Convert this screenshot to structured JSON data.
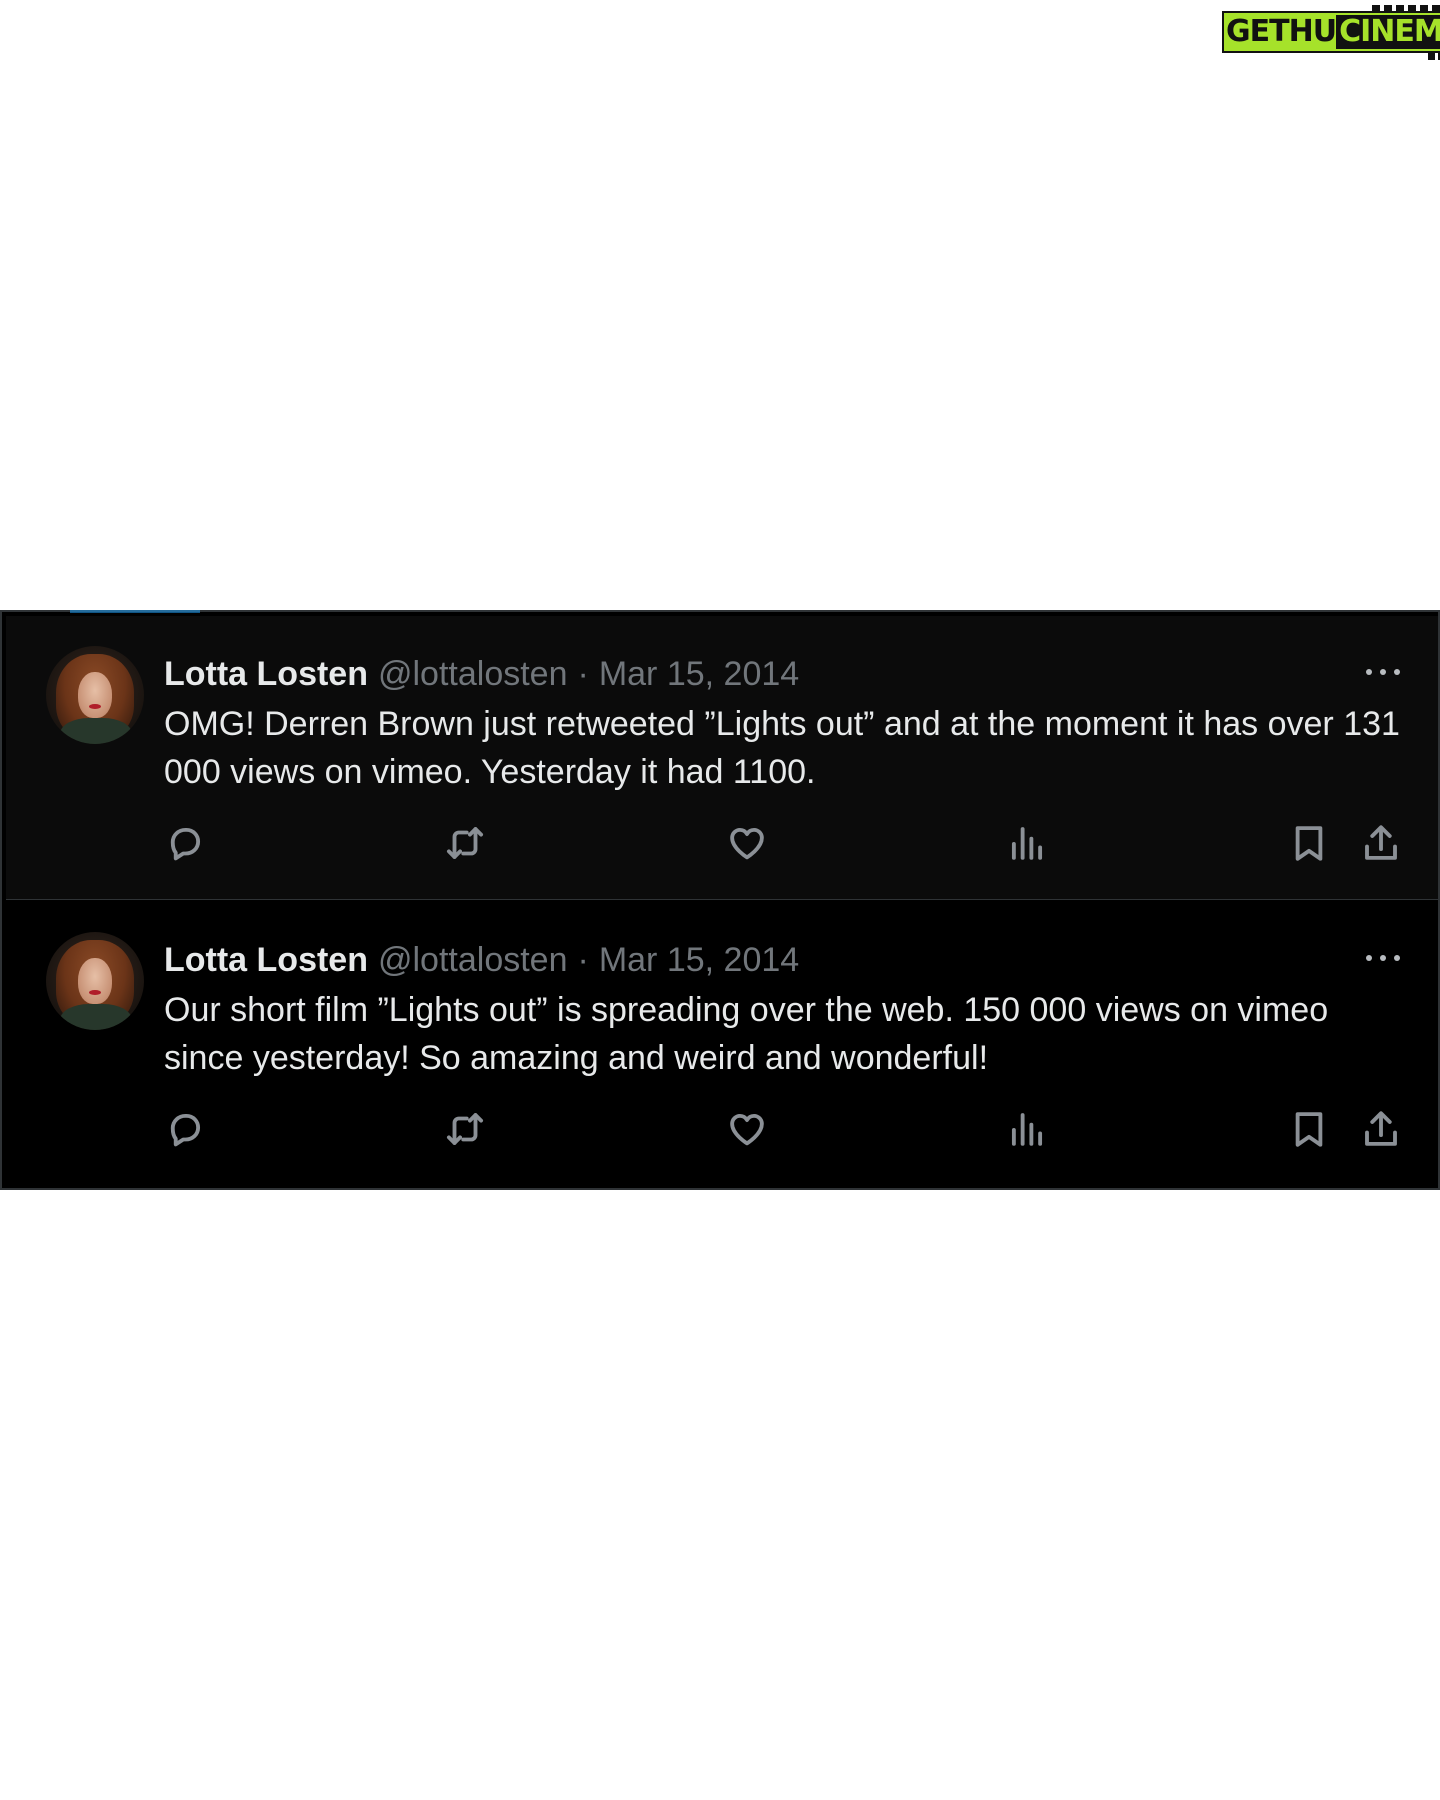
{
  "watermark": {
    "text_a": "GETHU",
    "text_b": "CINEMA"
  },
  "tweets": [
    {
      "name": "Lotta Losten",
      "handle": "@lottalosten",
      "separator": "·",
      "date": "Mar 15, 2014",
      "text": "OMG! Derren Brown just retweeted ”Lights out” and at the moment it has over 131 000 views on vimeo. Yesterday it had 1100."
    },
    {
      "name": "Lotta Losten",
      "handle": "@lottalosten",
      "separator": "·",
      "date": "Mar 15, 2014",
      "text": "Our short film ”Lights out” is spreading over the web. 150 000 views on vimeo since yesterday! So amazing and weird and wonderful!"
    }
  ],
  "icons": {
    "reply": "reply-icon",
    "retweet": "retweet-icon",
    "like": "heart-icon",
    "views": "analytics-icon",
    "bookmark": "bookmark-icon",
    "share": "share-icon",
    "more": "more-icon"
  },
  "colors": {
    "page_background": "#ffffff",
    "panel_background": "#000000",
    "primary_text": "#e7e9ea",
    "secondary_text": "#71767b",
    "icon": "#8b9096",
    "watermark_green": "#a6e22a"
  }
}
